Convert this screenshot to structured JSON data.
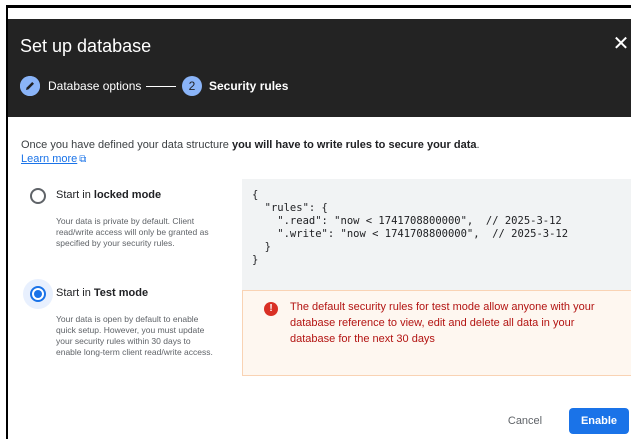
{
  "dialog": {
    "title": "Set up database",
    "close_icon": "close-icon"
  },
  "stepper": {
    "steps": [
      {
        "number": "1",
        "label": "Database options",
        "state": "completed",
        "icon": "pencil-icon"
      },
      {
        "number": "2",
        "label": "Security rules",
        "state": "active"
      }
    ]
  },
  "intro": {
    "text": "Once you have defined your data structure ",
    "bold": "you will have to write rules to secure your data",
    "end": ".",
    "learn_more": "Learn more",
    "learn_more_icon": "external-link-icon"
  },
  "options": [
    {
      "label_prefix": "Start in ",
      "label_bold": "locked mode",
      "description": "Your data is private by default. Client read/write access will only be granted as specified by your security rules.",
      "selected": false
    },
    {
      "label_prefix": "Start in ",
      "label_bold": "Test mode",
      "description": "Your data is open by default to enable quick setup. However, you must update your security rules within 30 days to enable long-term client read/write access.",
      "selected": true
    }
  ],
  "code": {
    "lines": [
      "{",
      "  \"rules\": {",
      "    \".read\": \"now < 1741708800000\",  // 2025-3-12",
      "    \".write\": \"now < 1741708800000\",  // 2025-3-12",
      "  }",
      "}"
    ]
  },
  "warning": {
    "icon": "exclamation-icon",
    "text": "The default security rules for test mode allow anyone with your database reference to view, edit and delete all data in your database for the next 30 days"
  },
  "footer": {
    "cancel_label": "Cancel",
    "enable_label": "Enable"
  },
  "colors": {
    "header_bg": "#232323",
    "accent": "#1a73e8",
    "step_circle": "#8ab4f8",
    "warning_text": "#b31412",
    "warning_bg": "#fef7f0",
    "warning_icon": "#d93025"
  }
}
